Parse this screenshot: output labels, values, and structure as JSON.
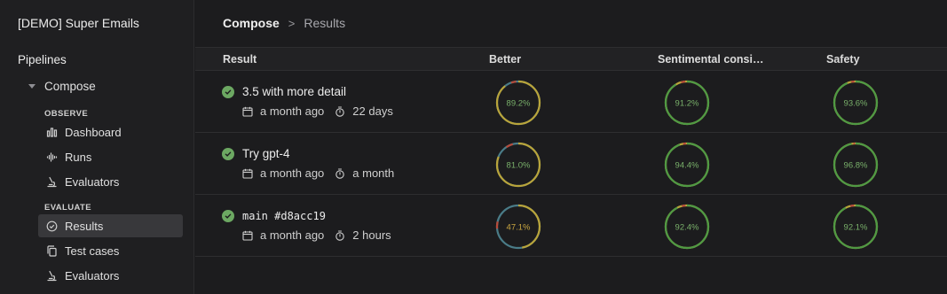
{
  "sidebar": {
    "org_name": "[DEMO] Super Emails",
    "section_title": "Pipelines",
    "pipeline": "Compose",
    "groups": [
      {
        "label": "OBSERVE",
        "items": [
          {
            "label": "Dashboard",
            "icon": "bar-chart-icon"
          },
          {
            "label": "Runs",
            "icon": "waveform-icon"
          },
          {
            "label": "Evaluators",
            "icon": "microscope-icon"
          }
        ]
      },
      {
        "label": "EVALUATE",
        "items": [
          {
            "label": "Results",
            "icon": "check-circle-icon",
            "active": true
          },
          {
            "label": "Test cases",
            "icon": "copy-icon"
          },
          {
            "label": "Evaluators",
            "icon": "microscope-icon"
          }
        ]
      }
    ]
  },
  "breadcrumb": {
    "root": "Compose",
    "separator": ">",
    "current": "Results"
  },
  "table": {
    "columns": [
      "Result",
      "Better",
      "Sentimental consi…",
      "Safety"
    ],
    "rows": [
      {
        "name": "3.5 with more detail",
        "mono": false,
        "created": "a month ago",
        "duration": "22 days",
        "scores": [
          {
            "label": "89.2%",
            "value": 0.892
          },
          {
            "label": "91.2%",
            "value": 0.912
          },
          {
            "label": "93.6%",
            "value": 0.936
          }
        ]
      },
      {
        "name": "Try gpt-4",
        "mono": false,
        "created": "a month ago",
        "duration": "a month",
        "scores": [
          {
            "label": "81.0%",
            "value": 0.81
          },
          {
            "label": "94.4%",
            "value": 0.944
          },
          {
            "label": "96.8%",
            "value": 0.968
          }
        ]
      },
      {
        "name": "main #d8acc19",
        "mono": true,
        "created": "a month ago",
        "duration": "2 hours",
        "scores": [
          {
            "label": "47.1%",
            "value": 0.471
          },
          {
            "label": "92.4%",
            "value": 0.924
          },
          {
            "label": "92.1%",
            "value": 0.921
          }
        ]
      }
    ]
  },
  "colors": {
    "status_success": "#6ca862",
    "gauge_green": "#4f9a44",
    "gauge_yellow": "#b9a43a",
    "gauge_red": "#b84a3a",
    "gauge_teal": "#4a7c88",
    "gauge_text_green": "#79b06a",
    "gauge_text_yellow": "#c9a640"
  }
}
